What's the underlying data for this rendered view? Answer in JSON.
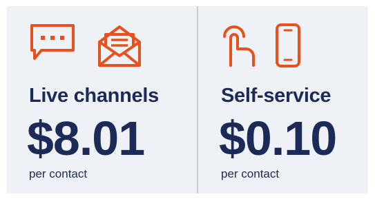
{
  "colors": {
    "background": "#eef1f5",
    "accent": "#e8501c",
    "text": "#1b2a57",
    "divider": "#c9ccd2"
  },
  "live": {
    "icons": [
      "chat-bubble-icon",
      "envelope-icon"
    ],
    "title": "Live channels",
    "price": "$8.01",
    "unit": "per contact"
  },
  "self_service": {
    "icons": [
      "tap-hand-icon",
      "mobile-phone-icon"
    ],
    "title": "Self-service",
    "price": "$0.10",
    "unit": "per contact"
  }
}
